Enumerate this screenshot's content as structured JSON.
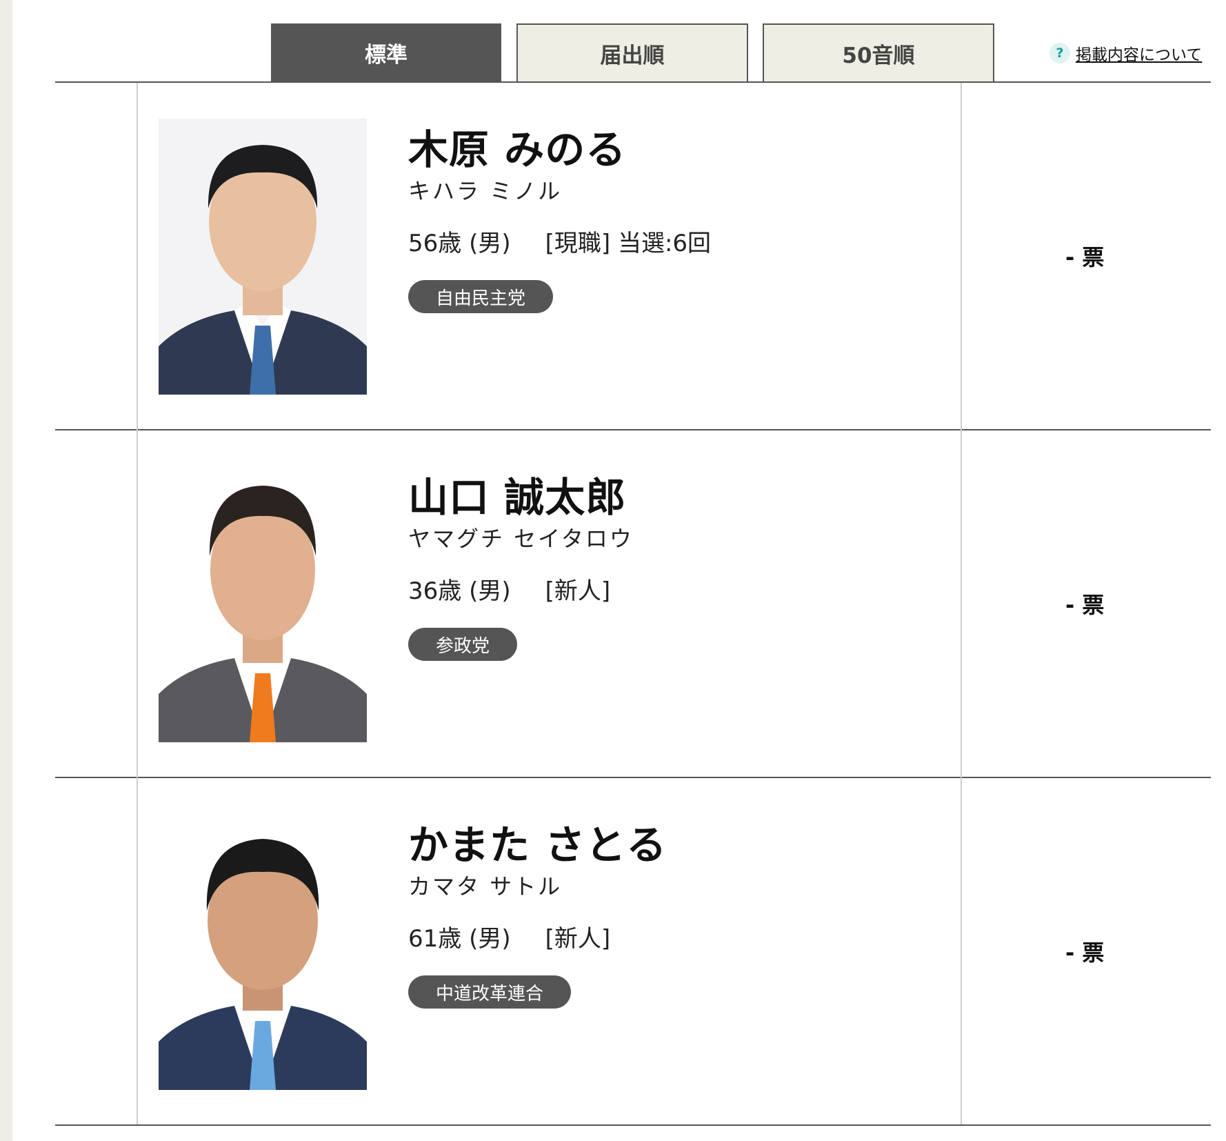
{
  "tabs": {
    "standard": "標準",
    "filing_order": "届出順",
    "syllabary_order": "50音順"
  },
  "help": {
    "icon": "?",
    "label": "掲載内容について"
  },
  "candidates": [
    {
      "name": "木原  みのる",
      "kana": "キハラ ミノル",
      "age_gender": "56歳 (男)",
      "status": "[現職] 当選:6回",
      "party": "自由民主党",
      "votes": "- 票",
      "tie_color": "#3f6fa8",
      "suit_color": "#2f3a52"
    },
    {
      "name": "山口  誠太郎",
      "kana": "ヤマグチ セイタロウ",
      "age_gender": "36歳 (男)",
      "status": "[新人]",
      "party": "参政党",
      "votes": "- 票",
      "tie_color": "#f07a1e",
      "suit_color": "#5a5a5e"
    },
    {
      "name": "かまた さとる",
      "kana": "カマタ サトル",
      "age_gender": "61歳 (男)",
      "status": "[新人]",
      "party": "中道改革連合",
      "votes": "- 票",
      "tie_color": "#6aa9e0",
      "suit_color": "#2c3b5c"
    }
  ]
}
